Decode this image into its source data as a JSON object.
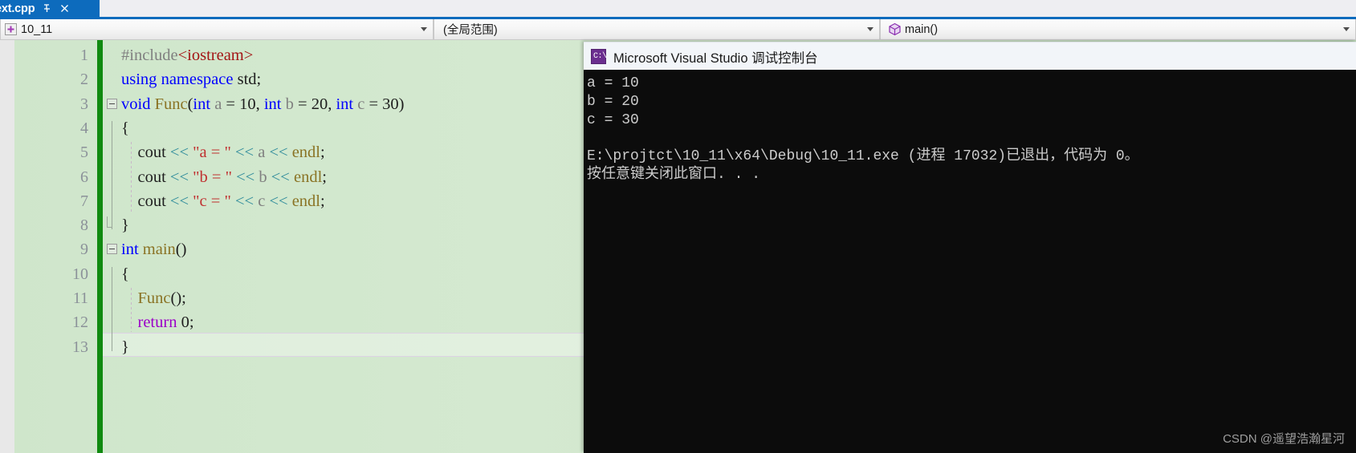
{
  "tab": {
    "title": "ext.cpp",
    "pin_icon": "pin-icon",
    "close_icon": "close-icon"
  },
  "navbar": {
    "project_combo": {
      "icon": "add-project-icon",
      "value": "10_11",
      "arrow_icon": "chevron-down-icon"
    },
    "scope_combo": {
      "value": "(全局范围)",
      "arrow_icon": "chevron-down-icon"
    },
    "member_combo": {
      "icon": "method-cube-icon",
      "value": "main()",
      "arrow_icon": "chevron-down-icon"
    }
  },
  "editor": {
    "line_numbers": [
      "1",
      "2",
      "3",
      "4",
      "5",
      "6",
      "7",
      "8",
      "9",
      "10",
      "11",
      "12",
      "13"
    ],
    "current_line": 13,
    "lines": [
      {
        "n": 1,
        "tokens": [
          {
            "t": "#include",
            "c": "k-gray"
          },
          {
            "t": "<iostream>",
            "c": "k-red"
          }
        ]
      },
      {
        "n": 2,
        "tokens": [
          {
            "t": "using",
            "c": "k-blue"
          },
          {
            "t": " ",
            "c": "k-black"
          },
          {
            "t": "namespace",
            "c": "k-blue"
          },
          {
            "t": " std;",
            "c": "k-black"
          }
        ]
      },
      {
        "n": 3,
        "tokens": [
          {
            "t": "void",
            "c": "k-blue"
          },
          {
            "t": " ",
            "c": "k-black"
          },
          {
            "t": "Func",
            "c": "k-olive"
          },
          {
            "t": "(",
            "c": "k-black"
          },
          {
            "t": "int",
            "c": "k-blue"
          },
          {
            "t": " ",
            "c": "k-black"
          },
          {
            "t": "a",
            "c": "k-gray"
          },
          {
            "t": " = 10, ",
            "c": "k-black"
          },
          {
            "t": "int",
            "c": "k-blue"
          },
          {
            "t": " ",
            "c": "k-black"
          },
          {
            "t": "b",
            "c": "k-gray"
          },
          {
            "t": " = 20, ",
            "c": "k-black"
          },
          {
            "t": "int",
            "c": "k-blue"
          },
          {
            "t": " ",
            "c": "k-black"
          },
          {
            "t": "c",
            "c": "k-gray"
          },
          {
            "t": " = 30)",
            "c": "k-black"
          }
        ]
      },
      {
        "n": 4,
        "tokens": [
          {
            "t": "{",
            "c": "k-black"
          }
        ]
      },
      {
        "n": 5,
        "tokens": [
          {
            "t": "    cout ",
            "c": "k-black"
          },
          {
            "t": "<<",
            "c": "k-teal"
          },
          {
            "t": " ",
            "c": "k-black"
          },
          {
            "t": "\"a = \"",
            "c": "k-darkred"
          },
          {
            "t": " ",
            "c": "k-black"
          },
          {
            "t": "<<",
            "c": "k-teal"
          },
          {
            "t": " ",
            "c": "k-black"
          },
          {
            "t": "a",
            "c": "k-gray"
          },
          {
            "t": " ",
            "c": "k-black"
          },
          {
            "t": "<<",
            "c": "k-teal"
          },
          {
            "t": " ",
            "c": "k-black"
          },
          {
            "t": "endl",
            "c": "k-olive"
          },
          {
            "t": ";",
            "c": "k-black"
          }
        ]
      },
      {
        "n": 6,
        "tokens": [
          {
            "t": "    cout ",
            "c": "k-black"
          },
          {
            "t": "<<",
            "c": "k-teal"
          },
          {
            "t": " ",
            "c": "k-black"
          },
          {
            "t": "\"b = \"",
            "c": "k-darkred"
          },
          {
            "t": " ",
            "c": "k-black"
          },
          {
            "t": "<<",
            "c": "k-teal"
          },
          {
            "t": " ",
            "c": "k-black"
          },
          {
            "t": "b",
            "c": "k-gray"
          },
          {
            "t": " ",
            "c": "k-black"
          },
          {
            "t": "<<",
            "c": "k-teal"
          },
          {
            "t": " ",
            "c": "k-black"
          },
          {
            "t": "endl",
            "c": "k-olive"
          },
          {
            "t": ";",
            "c": "k-black"
          }
        ]
      },
      {
        "n": 7,
        "tokens": [
          {
            "t": "    cout ",
            "c": "k-black"
          },
          {
            "t": "<<",
            "c": "k-teal"
          },
          {
            "t": " ",
            "c": "k-black"
          },
          {
            "t": "\"c = \"",
            "c": "k-darkred"
          },
          {
            "t": " ",
            "c": "k-black"
          },
          {
            "t": "<<",
            "c": "k-teal"
          },
          {
            "t": " ",
            "c": "k-black"
          },
          {
            "t": "c",
            "c": "k-gray"
          },
          {
            "t": " ",
            "c": "k-black"
          },
          {
            "t": "<<",
            "c": "k-teal"
          },
          {
            "t": " ",
            "c": "k-black"
          },
          {
            "t": "endl",
            "c": "k-olive"
          },
          {
            "t": ";",
            "c": "k-black"
          }
        ]
      },
      {
        "n": 8,
        "tokens": [
          {
            "t": "}",
            "c": "k-black"
          }
        ]
      },
      {
        "n": 9,
        "tokens": [
          {
            "t": "int",
            "c": "k-blue"
          },
          {
            "t": " ",
            "c": "k-black"
          },
          {
            "t": "main",
            "c": "k-olive"
          },
          {
            "t": "()",
            "c": "k-black"
          }
        ]
      },
      {
        "n": 10,
        "tokens": [
          {
            "t": "{",
            "c": "k-black"
          }
        ]
      },
      {
        "n": 11,
        "tokens": [
          {
            "t": "    ",
            "c": "k-black"
          },
          {
            "t": "Func",
            "c": "k-olive"
          },
          {
            "t": "();",
            "c": "k-black"
          }
        ]
      },
      {
        "n": 12,
        "tokens": [
          {
            "t": "    ",
            "c": "k-black"
          },
          {
            "t": "return",
            "c": "k-purple"
          },
          {
            "t": " 0;",
            "c": "k-black"
          }
        ]
      },
      {
        "n": 13,
        "tokens": [
          {
            "t": "}",
            "c": "k-black"
          }
        ]
      }
    ]
  },
  "console": {
    "icon": "cmd-prompt-icon",
    "icon_glyph": "C:\\",
    "title": "Microsoft Visual Studio 调试控制台",
    "output": [
      "a = 10",
      "b = 20",
      "c = 30",
      "",
      "E:\\projtct\\10_11\\x64\\Debug\\10_11.exe (进程 17032)已退出，代码为 0。",
      "按任意键关闭此窗口. . ."
    ]
  },
  "watermark": "CSDN @遥望浩瀚星河",
  "colors": {
    "tab_active": "#0d6bbd",
    "editor_background": "#d0e7cc",
    "change_bar": "#108a10",
    "console_background": "#0c0c0c",
    "console_text": "#cccccc",
    "keyword_blue": "#0000ff",
    "keyword_purple": "#9b00c8",
    "string_red": "#c03030",
    "operator_teal": "#2e8b9b",
    "function_olive": "#8a7324"
  }
}
